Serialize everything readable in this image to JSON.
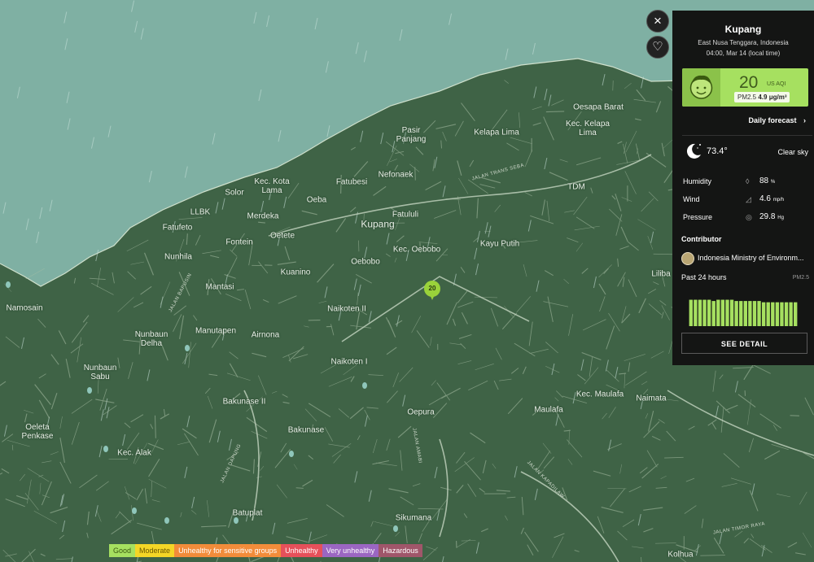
{
  "map": {
    "place_labels": [
      {
        "text": "Oesapa Barat",
        "big": false
      },
      {
        "text": "Kec. Kelapa\nLima",
        "big": false
      },
      {
        "text": "Pasir\nPanjang",
        "big": false
      },
      {
        "text": "Kelapa Lima",
        "big": false
      },
      {
        "text": "Kec. Kota\nLama",
        "big": false
      },
      {
        "text": "Solor",
        "big": false
      },
      {
        "text": "Fatubesi",
        "big": false
      },
      {
        "text": "Nefonaek",
        "big": false
      },
      {
        "text": "Oeba",
        "big": false
      },
      {
        "text": "TDM",
        "big": false
      },
      {
        "text": "LLBK",
        "big": false
      },
      {
        "text": "Merdeka",
        "big": false
      },
      {
        "text": "Fatululi",
        "big": false
      },
      {
        "text": "Kupang",
        "big": true
      },
      {
        "text": "Fatufeto",
        "big": false
      },
      {
        "text": "Oetete",
        "big": false
      },
      {
        "text": "Fontein",
        "big": false
      },
      {
        "text": "Kec. Oebobo",
        "big": false
      },
      {
        "text": "Kayu Putih",
        "big": false
      },
      {
        "text": "Nunhila",
        "big": false
      },
      {
        "text": "Oebobo",
        "big": false
      },
      {
        "text": "Kuanino",
        "big": false
      },
      {
        "text": "Liliba",
        "big": false
      },
      {
        "text": "Mantasi",
        "big": false
      },
      {
        "text": "Namosain",
        "big": false
      },
      {
        "text": "Naikoten II",
        "big": false
      },
      {
        "text": "Manutapen",
        "big": false
      },
      {
        "text": "Airnona",
        "big": false
      },
      {
        "text": "Nunbaun\nDelha",
        "big": false
      },
      {
        "text": "Naikoten I",
        "big": false
      },
      {
        "text": "Nunbaun\nSabu",
        "big": false
      },
      {
        "text": "Kec. Maulafa",
        "big": false
      },
      {
        "text": "Naimata",
        "big": false
      },
      {
        "text": "Bakunase II",
        "big": false
      },
      {
        "text": "Maulafa",
        "big": false
      },
      {
        "text": "Oepura",
        "big": false
      },
      {
        "text": "Oeleta\nPenkase",
        "big": false
      },
      {
        "text": "Bakunase",
        "big": false
      },
      {
        "text": "Kec. Alak",
        "big": false
      },
      {
        "text": "Batuplat",
        "big": false
      },
      {
        "text": "Sikumana",
        "big": false
      },
      {
        "text": "Kolhua",
        "big": false
      }
    ],
    "road_labels": [
      "JALAN TRANS SEBA",
      "JALAN BAPUSIN",
      "JALAN AMABI",
      "JALAN DAPUNG",
      "JALAN KAPADILAW",
      "JALAN TIMOR RAYA"
    ],
    "station_pin_value": "20",
    "colors": {
      "sea": "#7fb0a3",
      "land": "#3f6346",
      "roads": "#a9bfa5",
      "pin": "#9ad23a"
    }
  },
  "controls": {
    "close_icon": "×",
    "favorite_icon": "♡"
  },
  "panel": {
    "city": "Kupang",
    "region": "East Nusa Tenggara, Indonesia",
    "time": "04:00, Mar 14  (local time)",
    "aqi": "20",
    "aqi_unit": "US AQI",
    "pm_label": "PM2.5",
    "pm_value": "4.9 μg/m³",
    "daily_forecast": "Daily forecast",
    "temperature": "73.4°",
    "condition": "Clear sky",
    "humidity_label": "Humidity",
    "humidity_value": "88",
    "humidity_unit": "%",
    "wind_label": "Wind",
    "wind_value": "4.6",
    "wind_unit": "mp/h",
    "pressure_label": "Pressure",
    "pressure_value": "29.8",
    "pressure_unit": "Hg",
    "contributor_heading": "Contributor",
    "contributor_name": "Indonesia Ministry of Environm...",
    "past_label": "Past 24 hours",
    "past_pollutant": "PM2.5",
    "history_aqi": [
      21,
      21,
      21,
      21,
      21,
      20,
      21,
      21,
      21,
      21,
      20,
      20,
      20,
      20,
      20,
      20,
      19,
      19,
      19,
      19,
      19,
      19,
      19,
      19
    ],
    "see_detail": "SEE DETAIL",
    "accent": "#a6e060"
  },
  "legend": [
    {
      "label": "Good",
      "bg": "#a6e060",
      "fg": "#3a5a10"
    },
    {
      "label": "Moderate",
      "bg": "#f4d626",
      "fg": "#6a5800"
    },
    {
      "label": "Unhealthy for sensitive groups",
      "bg": "#f28c3a",
      "fg": "#ffffff"
    },
    {
      "label": "Unhealthy",
      "bg": "#e6505a",
      "fg": "#ffffff"
    },
    {
      "label": "Very unhealthy",
      "bg": "#9b66c2",
      "fg": "#ffffff"
    },
    {
      "label": "Hazardous",
      "bg": "#a0566a",
      "fg": "#ffffff"
    }
  ]
}
